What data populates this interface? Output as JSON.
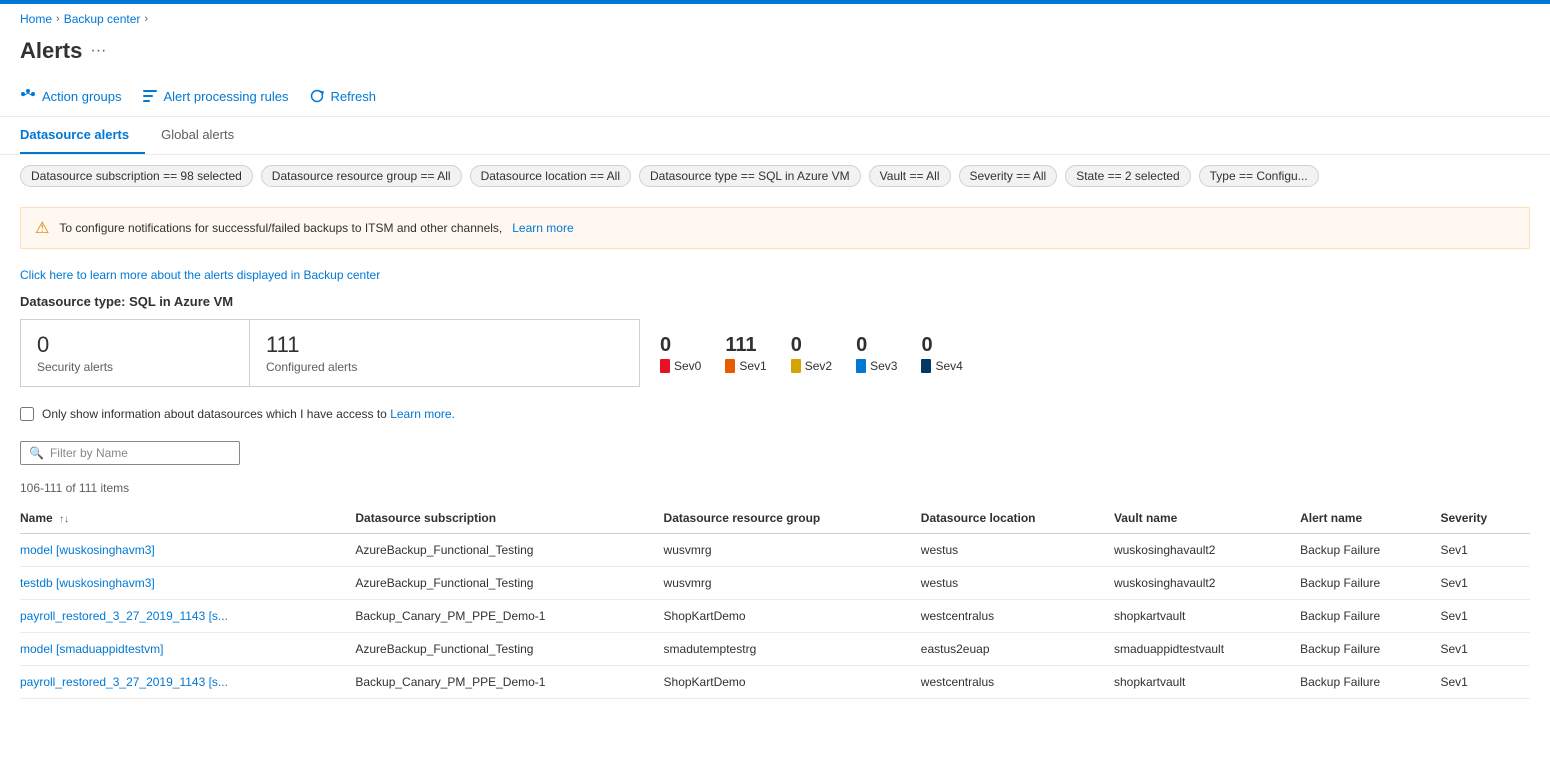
{
  "topbar": {
    "color": "#0078d4"
  },
  "breadcrumb": {
    "items": [
      "Home",
      "Backup center"
    ],
    "separator": "›"
  },
  "page": {
    "title": "Alerts",
    "menu_icon": "···"
  },
  "toolbar": {
    "action_groups_label": "Action groups",
    "alert_processing_rules_label": "Alert processing rules",
    "refresh_label": "Refresh"
  },
  "tabs": [
    {
      "label": "Datasource alerts",
      "active": true
    },
    {
      "label": "Global alerts",
      "active": false
    }
  ],
  "filters": [
    {
      "text": "Datasource subscription == 98 selected"
    },
    {
      "text": "Datasource resource group == All"
    },
    {
      "text": "Datasource location == All"
    },
    {
      "text": "Datasource type == SQL in Azure VM"
    },
    {
      "text": "Vault == All"
    },
    {
      "text": "Severity == All"
    },
    {
      "text": "State == 2 selected"
    },
    {
      "text": "Type == Configu..."
    }
  ],
  "warning": {
    "text": "To configure notifications for successful/failed backups to ITSM and other channels,",
    "link_text": "Learn more"
  },
  "info_link": {
    "text": "Click here to learn more about the alerts displayed in Backup center"
  },
  "datasource_type_label": "Datasource type: SQL in Azure VM",
  "stats": {
    "security_alerts": {
      "number": "0",
      "label": "Security alerts"
    },
    "configured_alerts": {
      "number": "111",
      "label": "Configured alerts"
    }
  },
  "severity_stats": [
    {
      "key": "sev0",
      "number": "0",
      "label": "Sev0",
      "color_class": "sev0-color"
    },
    {
      "key": "sev1",
      "number": "111",
      "label": "Sev1",
      "color_class": "sev1-color"
    },
    {
      "key": "sev2",
      "number": "0",
      "label": "Sev2",
      "color_class": "sev2-color"
    },
    {
      "key": "sev3",
      "number": "0",
      "label": "Sev3",
      "color_class": "sev3-color"
    },
    {
      "key": "sev4",
      "number": "0",
      "label": "Sev4",
      "color_class": "sev4-color"
    }
  ],
  "checkbox": {
    "label": "Only show information about datasources which I have access to",
    "link_text": "Learn more."
  },
  "search": {
    "placeholder": "Filter by Name"
  },
  "item_count": "106-111 of 111 items",
  "table": {
    "columns": [
      {
        "label": "Name",
        "sortable": true
      },
      {
        "label": "Datasource subscription",
        "sortable": false
      },
      {
        "label": "Datasource resource group",
        "sortable": false
      },
      {
        "label": "Datasource location",
        "sortable": false
      },
      {
        "label": "Vault name",
        "sortable": false
      },
      {
        "label": "Alert name",
        "sortable": false
      },
      {
        "label": "Severity",
        "sortable": false
      }
    ],
    "rows": [
      {
        "name": "model [wuskosinghavm3]",
        "subscription": "AzureBackup_Functional_Testing",
        "resource_group": "wusvmrg",
        "location": "westus",
        "vault": "wuskosinghavault2",
        "alert_name": "Backup Failure",
        "severity": "Sev1"
      },
      {
        "name": "testdb [wuskosinghavm3]",
        "subscription": "AzureBackup_Functional_Testing",
        "resource_group": "wusvmrg",
        "location": "westus",
        "vault": "wuskosinghavault2",
        "alert_name": "Backup Failure",
        "severity": "Sev1"
      },
      {
        "name": "payroll_restored_3_27_2019_1143 [s...",
        "subscription": "Backup_Canary_PM_PPE_Demo-1",
        "resource_group": "ShopKartDemo",
        "location": "westcentralus",
        "vault": "shopkartvault",
        "alert_name": "Backup Failure",
        "severity": "Sev1"
      },
      {
        "name": "model [smaduappidtestvm]",
        "subscription": "AzureBackup_Functional_Testing",
        "resource_group": "smadutemptestrg",
        "location": "eastus2euap",
        "vault": "smaduappidtestvault",
        "alert_name": "Backup Failure",
        "severity": "Sev1"
      },
      {
        "name": "payroll_restored_3_27_2019_1143 [s...",
        "subscription": "Backup_Canary_PM_PPE_Demo-1",
        "resource_group": "ShopKartDemo",
        "location": "westcentralus",
        "vault": "shopkartvault",
        "alert_name": "Backup Failure",
        "severity": "Sev1"
      }
    ]
  }
}
